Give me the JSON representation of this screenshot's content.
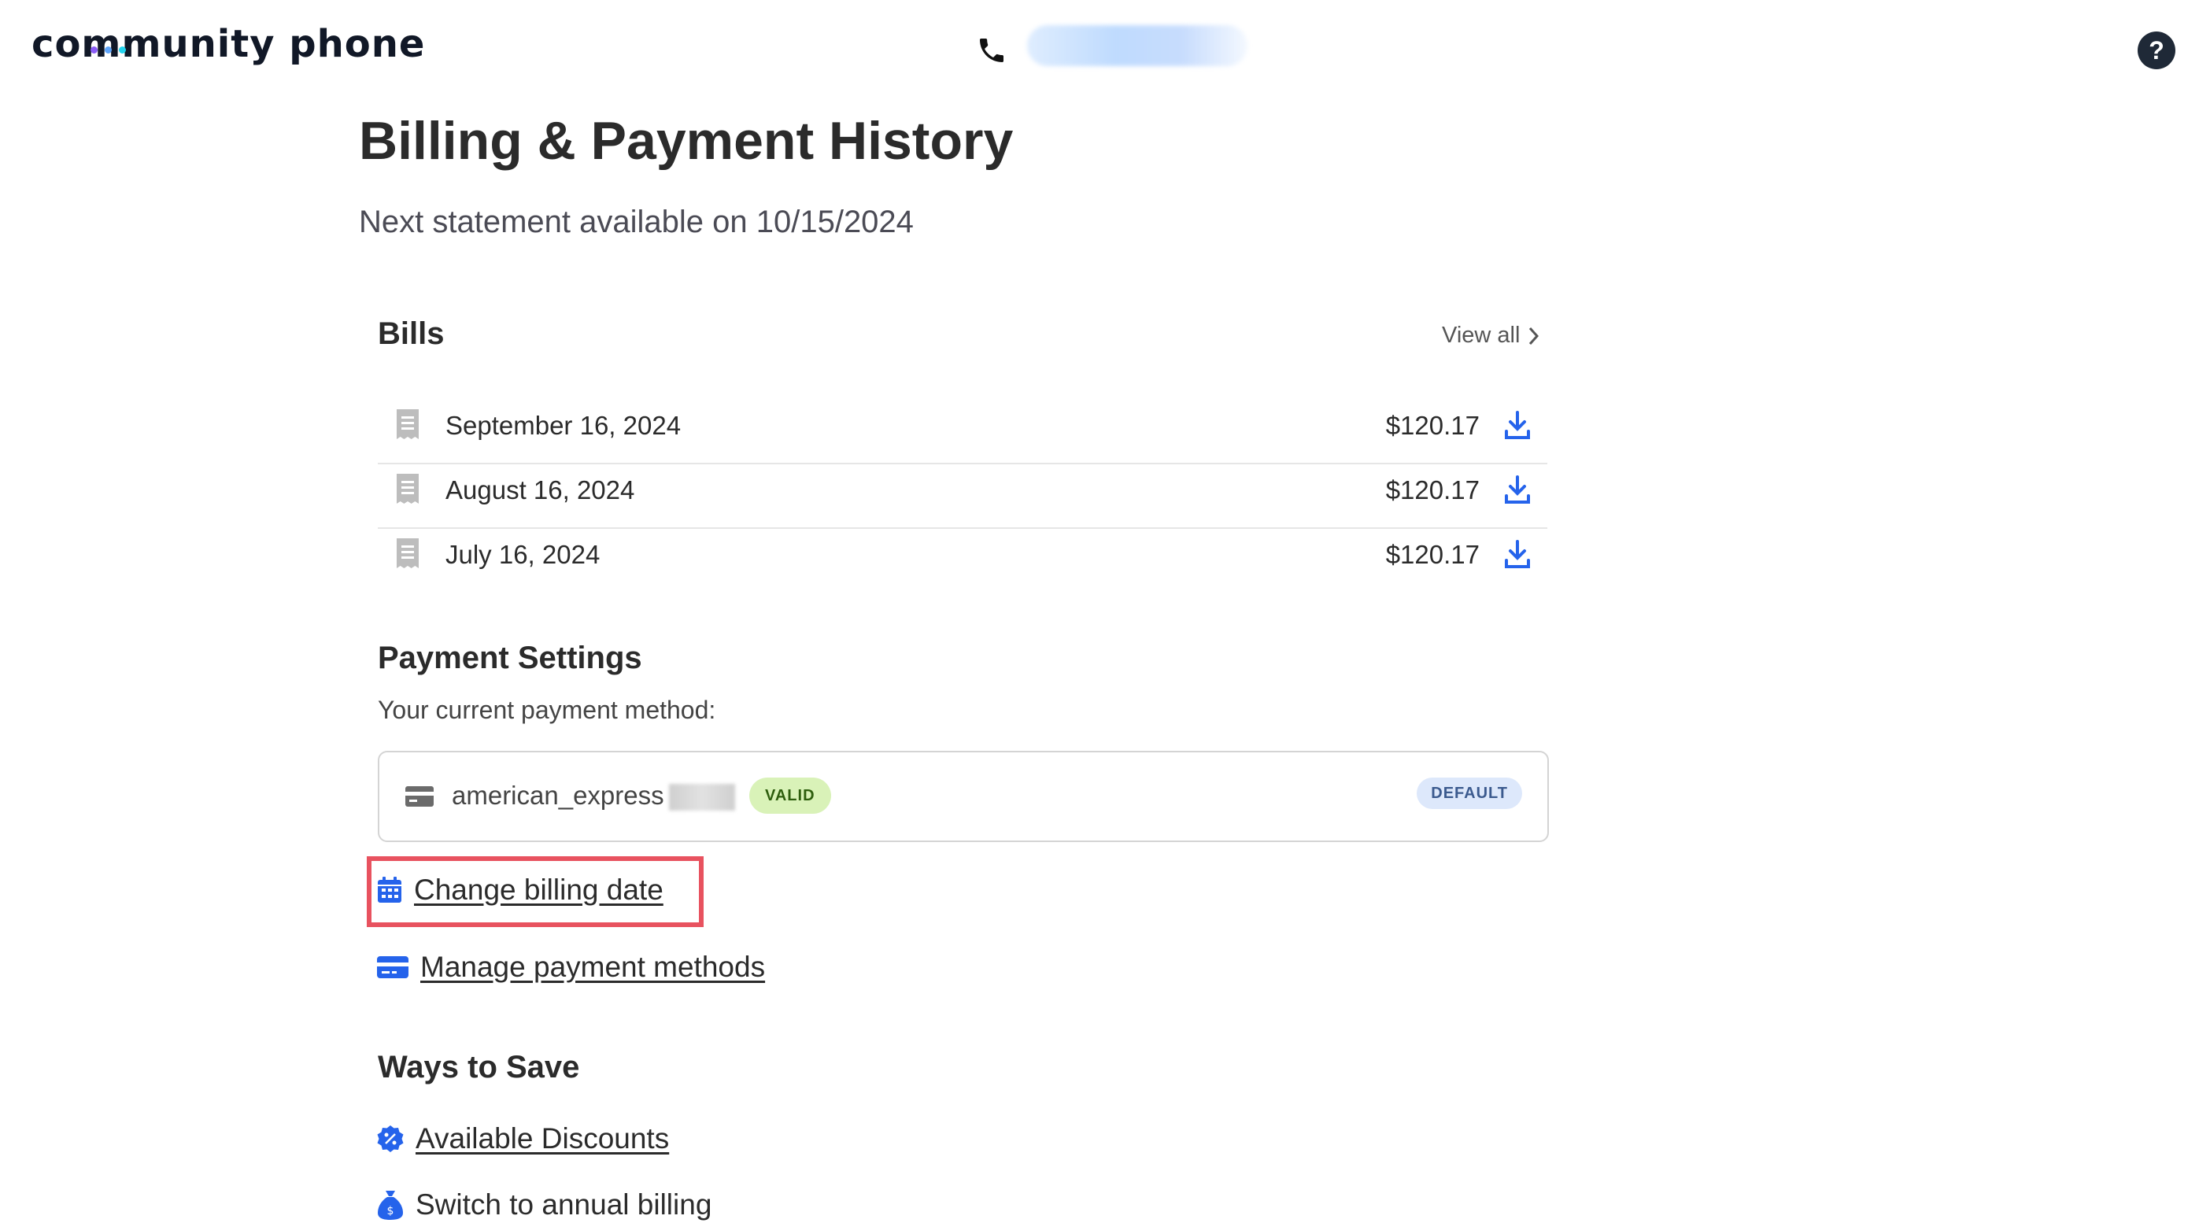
{
  "header": {
    "logo_text": "community phone",
    "logo_dot_colors": [
      "#8b5cf6",
      "#60a5fa",
      "#22d3ee"
    ],
    "phone_number": "",
    "help_label": "?"
  },
  "page": {
    "title": "Billing & Payment History",
    "subtitle": "Next statement available on 10/15/2024"
  },
  "bills": {
    "heading": "Bills",
    "view_all": "View all",
    "items": [
      {
        "date": "September 16, 2024",
        "amount": "$120.17"
      },
      {
        "date": "August 16, 2024",
        "amount": "$120.17"
      },
      {
        "date": "July 16, 2024",
        "amount": "$120.17"
      }
    ]
  },
  "payment_settings": {
    "heading": "Payment Settings",
    "current_label": "Your current payment method:",
    "method": {
      "name": "american_express",
      "status_badge": "VALID",
      "default_badge": "DEFAULT"
    },
    "change_billing_date": "Change billing date",
    "manage_payment_methods": "Manage payment methods"
  },
  "ways_to_save": {
    "heading": "Ways to Save",
    "available_discounts": "Available Discounts",
    "switch_annual": "Switch to annual billing"
  },
  "colors": {
    "accent_blue": "#2563eb",
    "highlight_red": "#e8525f",
    "valid_green_bg": "#d9f2b8",
    "default_blue_bg": "#dde8fb"
  }
}
